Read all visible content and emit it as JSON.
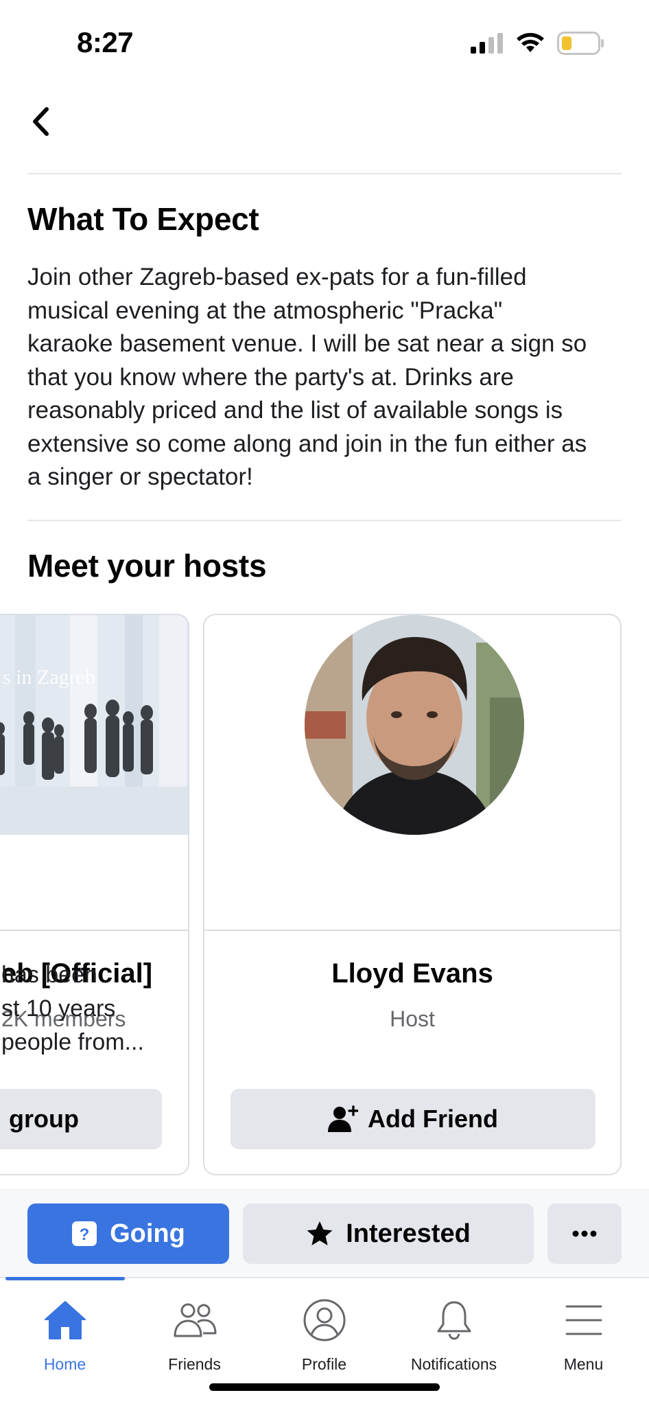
{
  "status_bar": {
    "time": "8:27"
  },
  "sections": {
    "expect": {
      "title": "What To Expect",
      "lines": [
        "Join other Zagreb-based ex-pats for a fun-filled",
        "musical evening at the atmospheric \"Pracka\"",
        "karaoke basement venue. I will be sat near a sign so",
        "that you know where the party's at. Drinks are",
        "reasonably priced and the list of available songs is",
        "extensive so come along and join in the fun either as",
        "a singer or spectator!"
      ]
    },
    "hosts": {
      "title": "Meet your hosts"
    }
  },
  "hosts": [
    {
      "image_text": "s in Zagreb",
      "name": "eb [Official]",
      "subtitle": "2K members",
      "description_lines": [
        "has been",
        "st 10 years",
        "people from..."
      ],
      "button_label": "group"
    },
    {
      "name": "Lloyd Evans",
      "subtitle": "Host",
      "button_label": "Add Friend"
    }
  ],
  "actions": {
    "going": "Going",
    "interested": "Interested",
    "more_icon": "more-horizontal-icon"
  },
  "tabs": [
    {
      "label": "Home",
      "icon": "home-icon",
      "active": true
    },
    {
      "label": "Friends",
      "icon": "friends-icon",
      "active": false
    },
    {
      "label": "Profile",
      "icon": "profile-icon",
      "active": false
    },
    {
      "label": "Notifications",
      "icon": "bell-icon",
      "active": false
    },
    {
      "label": "Menu",
      "icon": "menu-icon",
      "active": false
    }
  ],
  "colors": {
    "accent": "#3a74e0",
    "button_gray": "#e4e6eb",
    "secondary_text": "#65676b"
  }
}
